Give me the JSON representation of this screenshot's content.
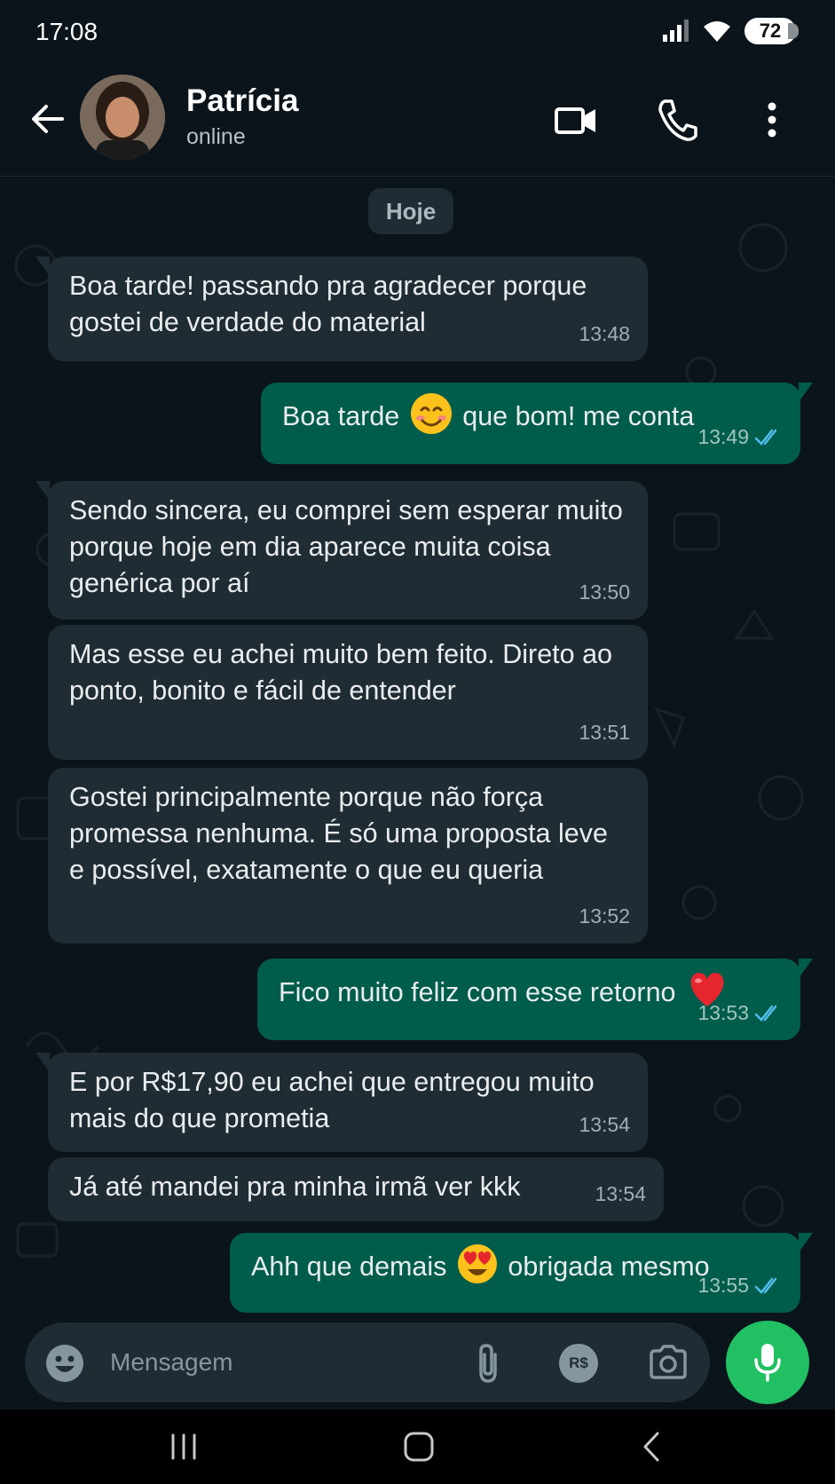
{
  "status_bar": {
    "time": "17:08",
    "battery": "72"
  },
  "header": {
    "contact_name": "Patrícia",
    "contact_status": "online"
  },
  "date_chip": "Hoje",
  "messages": [
    {
      "direction": "in",
      "text": "Boa tarde! passando pra agradecer porque gostei de verdade do material",
      "time": "13:48"
    },
    {
      "direction": "out",
      "text_before": "Boa tarde",
      "text_after": "que bom! me conta",
      "time": "13:49",
      "emoji": "smiling-face"
    },
    {
      "direction": "in",
      "text": "Sendo sincera, eu comprei sem esperar muito porque hoje em dia aparece muita coisa genérica por aí",
      "time": "13:50"
    },
    {
      "direction": "in",
      "text": "Mas esse eu achei muito bem feito. Direto ao ponto, bonito e fácil de entender",
      "time": "13:51"
    },
    {
      "direction": "in",
      "text": "Gostei principalmente porque não força promessa nenhuma. É só uma proposta leve e possível, exatamente o que eu queria",
      "time": "13:52"
    },
    {
      "direction": "out",
      "text": "Fico muito feliz com esse retorno",
      "time": "13:53",
      "emoji": "red-heart"
    },
    {
      "direction": "in",
      "text": "E por R$17,90 eu achei que entregou muito mais do que prometia",
      "time": "13:54"
    },
    {
      "direction": "in",
      "text": "Já até mandei pra minha irmã ver kkk",
      "time": "13:54"
    },
    {
      "direction": "out",
      "text_before": "Ahh que demais",
      "text_after": "obrigada mesmo",
      "time": "13:55",
      "emoji": "heart-eyes-face"
    }
  ],
  "input": {
    "placeholder": "Mensagem",
    "currency_label": "R$"
  },
  "colors": {
    "background": "#0b141a",
    "incoming_bubble": "#202c33",
    "outgoing_bubble": "#005c4b",
    "read_ticks": "#53bdeb",
    "mic_button": "#21c063"
  }
}
